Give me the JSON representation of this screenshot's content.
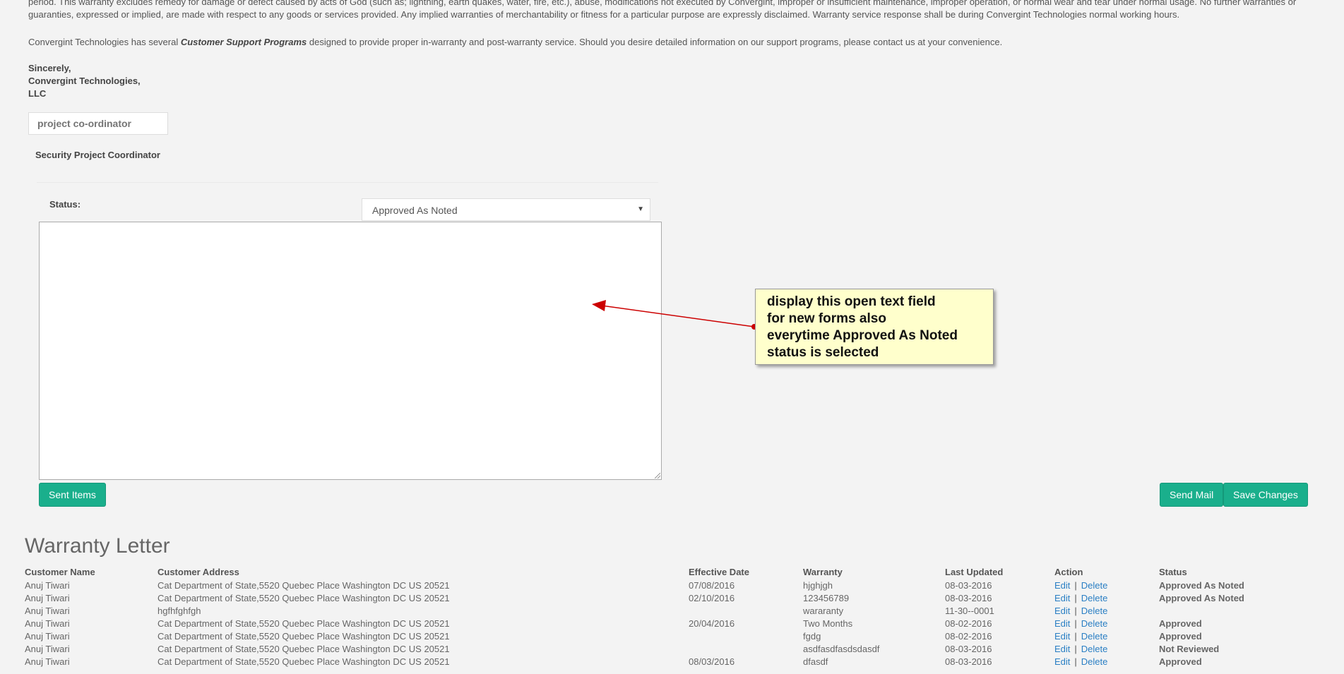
{
  "letter": {
    "warranty_paragraph": "period. This warranty excludes remedy for damage or defect caused by acts of God (such as; lightning, earth quakes, water, fire, etc.), abuse, modifications not executed by Convergint, improper or insufficient maintenance, improper operation, or normal wear and tear under normal usage. No further warranties or guaranties, expressed or implied, are made with respect to any goods or services provided. Any implied warranties of merchantability or fitness for a particular purpose are expressly disclaimed. Warranty service response shall be during Convergint Technologies normal working hours.",
    "support_before": "Convergint Technologies has several ",
    "support_emph": "Customer Support Programs",
    "support_after": " designed to provide proper in-warranty and post-warranty service. Should you desire detailed information on our support programs, please contact us at your convenience.",
    "sign_line1": "Sincerely,",
    "sign_line2": "Convergint Technologies,",
    "sign_line3": "LLC",
    "coordinator_placeholder": "project co-ordinator",
    "coordinator_title": "Security Project Coordinator"
  },
  "status": {
    "label": "Status:",
    "selected": "Approved As Noted",
    "notes_value": ""
  },
  "buttons": {
    "sent_items": "Sent Items",
    "send_mail": "Send Mail",
    "save_changes": "Save Changes"
  },
  "annotation": {
    "line1": "display this open text field",
    "line2": "for new forms also",
    "line3": "everytime Approved As Noted",
    "line4": "status is selected",
    "color": "#ffffcc",
    "arrow_color": "#cc0000"
  },
  "warranty_letter": {
    "heading": "Warranty Letter",
    "columns": [
      "Customer Name",
      "Customer Address",
      "Effective Date",
      "Warranty",
      "Last Updated",
      "Action",
      "Status"
    ],
    "edit_label": "Edit",
    "delete_label": "Delete",
    "rows": [
      {
        "name": "Anuj Tiwari",
        "address": "Cat Department of State,5520 Quebec Place Washington DC US 20521",
        "effective": "07/08/2016",
        "warranty": "hjghjgh",
        "updated": "08-03-2016",
        "status": "Approved As Noted"
      },
      {
        "name": "Anuj Tiwari",
        "address": "Cat Department of State,5520 Quebec Place Washington DC US 20521",
        "effective": "02/10/2016",
        "warranty": "123456789",
        "updated": "08-03-2016",
        "status": "Approved As Noted"
      },
      {
        "name": "Anuj Tiwari",
        "address": "hgfhfghfgh",
        "effective": "",
        "warranty": "wararanty",
        "updated": "11-30--0001",
        "status": ""
      },
      {
        "name": "Anuj Tiwari",
        "address": "Cat Department of State,5520 Quebec Place Washington DC US 20521",
        "effective": "20/04/2016",
        "warranty": "Two Months",
        "updated": "08-02-2016",
        "status": "Approved"
      },
      {
        "name": "Anuj Tiwari",
        "address": "Cat Department of State,5520 Quebec Place Washington DC US 20521",
        "effective": "",
        "warranty": "fgdg",
        "updated": "08-02-2016",
        "status": "Approved"
      },
      {
        "name": "Anuj Tiwari",
        "address": "Cat Department of State,5520 Quebec Place Washington DC US 20521",
        "effective": "",
        "warranty": "asdfasdfasdsdasdf",
        "updated": "08-03-2016",
        "status": "Not Reviewed"
      },
      {
        "name": "Anuj Tiwari",
        "address": "Cat Department of State,5520 Quebec Place Washington DC US 20521",
        "effective": "08/03/2016",
        "warranty": "dfasdf",
        "updated": "08-03-2016",
        "status": "Approved"
      }
    ]
  }
}
